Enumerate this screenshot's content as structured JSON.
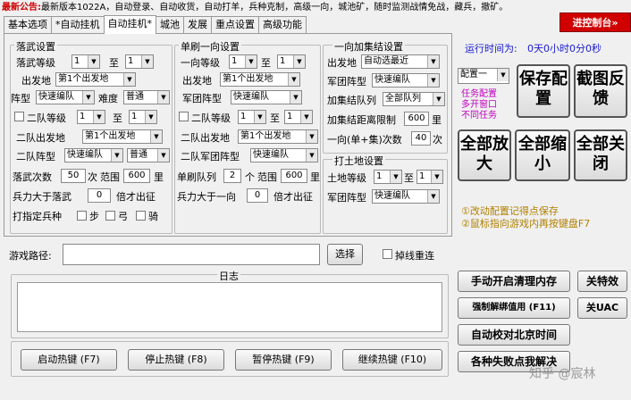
{
  "announcement": {
    "label": "最新公告:",
    "text": "最新版本1022A，自动登录、自动收货，自动打羊，兵种克制，高级一向，城池矿，随时监测战情免战，藏兵，撤矿。"
  },
  "console_button": "进控制台»",
  "tabs": [
    "基本选项",
    "*自动挂机",
    "自动挂机*",
    "城池",
    "发展",
    "重点设置",
    "高级功能"
  ],
  "left_group": {
    "title": "落武设置",
    "level_label": "落武等级",
    "level_from": "1",
    "to_label": "至",
    "level_to": "1",
    "origin_label": "出发地",
    "origin_value": "第1个出发地",
    "formation_label": "阵型",
    "formation_value": "快速编队",
    "difficulty_label": "难度",
    "difficulty_value": "普通",
    "team2_level_label": "二队等级",
    "team2_from": "1",
    "team2_to_label": "至",
    "team2_to": "1",
    "team2_origin_label": "二队出发地",
    "team2_origin_value": "第1个出发地",
    "team2_formation_label": "二队阵型",
    "team2_formation_value": "快速编队",
    "team2_difficulty": "普通",
    "times_label": "落武次数",
    "times_value": "50",
    "times_unit": "次",
    "range_label": "范围",
    "range_value": "600",
    "range_unit": "里",
    "troop_label": "兵力大于落武",
    "troop_value": "0",
    "troop_suffix": "倍才出征",
    "troop_type_label": "打指定兵种",
    "troop_types": [
      "步",
      "弓",
      "骑"
    ]
  },
  "mid_group": {
    "title": "单刷一向设置",
    "level_label": "一向等级",
    "level_from": "1",
    "to_label": "至",
    "level_to": "1",
    "origin_label": "出发地",
    "origin_value": "第1个出发地",
    "corps_label": "军团阵型",
    "corps_value": "快速编队",
    "team2_level_label": "二队等级",
    "team2_from": "1",
    "team2_to_label": "至",
    "team2_to": "1",
    "team2_origin_label": "二队出发地",
    "team2_origin_value": "第1个出发地",
    "team2_corps_label": "二队军团阵型",
    "team2_corps_value": "快速编队",
    "queue_label": "单刷队列",
    "queue_value": "2",
    "queue_unit": "个",
    "range_label": "范围",
    "range_value": "600",
    "range_unit": "里",
    "troop_label": "兵力大于一向",
    "troop_value": "0",
    "troop_suffix": "倍才出征"
  },
  "right_group": {
    "title": "一向加集结设置",
    "origin_label": "出发地",
    "origin_value": "自动选最近",
    "corps_label": "军团阵型",
    "corps_value": "快速编队",
    "queue_label": "加集结队列",
    "queue_value": "全部队列",
    "dist_label": "加集结距离限制",
    "dist_value": "600",
    "dist_unit": "里",
    "count_label": "一向(单+集)次数",
    "count_value": "40",
    "count_unit": "次"
  },
  "land_group": {
    "title": "打土地设置",
    "level_label": "土地等级",
    "level_from": "1",
    "to_label": "至",
    "level_to": "1",
    "corps_label": "军团阵型",
    "corps_value": "快速编队"
  },
  "runtime": {
    "label": "运行时间为:",
    "value": "0天0小时0分0秒"
  },
  "config": {
    "select_value": "配置一",
    "hint1": "任务配置",
    "hint2": "多开窗口",
    "hint3": "不同任务",
    "save": "保存配置",
    "screenshot": "截图反馈",
    "zoom_in": "全部放大",
    "zoom_out": "全部缩小",
    "close_all": "全部关闭"
  },
  "notes": [
    "①改动配置记得点保存",
    "②鼠标指向游戏内再按键盘F7"
  ],
  "game_path": {
    "label": "游戏路径:",
    "value": "",
    "browse": "选择",
    "reconnect": "掉线重连"
  },
  "log": {
    "title": "日志",
    "content": ""
  },
  "hotkeys": [
    "启动热键 (F7)",
    "停止热键 (F8)",
    "暂停热键 (F9)",
    "继续热键 (F10)"
  ],
  "side_buttons": {
    "clean_memory": "手动开启清理内存",
    "special_effects": "关特效",
    "unbind": "强制解绑值用 (F11)",
    "uac": "关UAC",
    "beijing_time": "自动校对北京时间",
    "failure": "各种失败点我解决"
  },
  "watermark": "知乎 @宸林"
}
